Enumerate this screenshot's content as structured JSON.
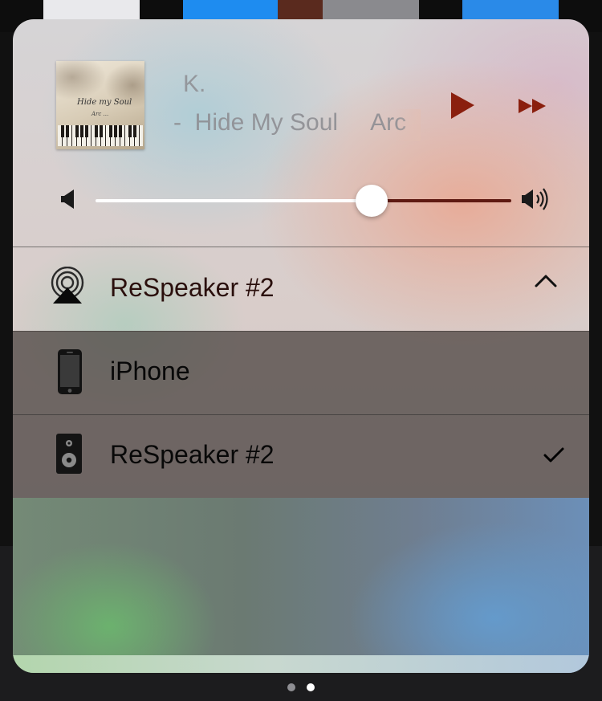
{
  "now_playing": {
    "artist": "K.",
    "title": "-  Hide My Soul     Arc",
    "artwork_caption_line1": "Hide my Soul",
    "artwork_caption_line2": "Arc ..."
  },
  "playback": {
    "play_icon": "play-icon",
    "next_icon": "fast-forward-icon",
    "accent_color": "#8a1f0e"
  },
  "volume": {
    "level": 0.6,
    "min_icon": "speaker-low-icon",
    "max_icon": "speaker-high-icon"
  },
  "route": {
    "current_label": "ReSpeaker #2",
    "icon": "airplay-icon",
    "expand_icon": "chevron-up-icon"
  },
  "devices": [
    {
      "label": "iPhone",
      "icon": "iphone-icon",
      "selected": false
    },
    {
      "label": "ReSpeaker #2",
      "icon": "speaker-icon",
      "selected": true
    }
  ],
  "pager": {
    "count": 2,
    "active_index": 1
  }
}
